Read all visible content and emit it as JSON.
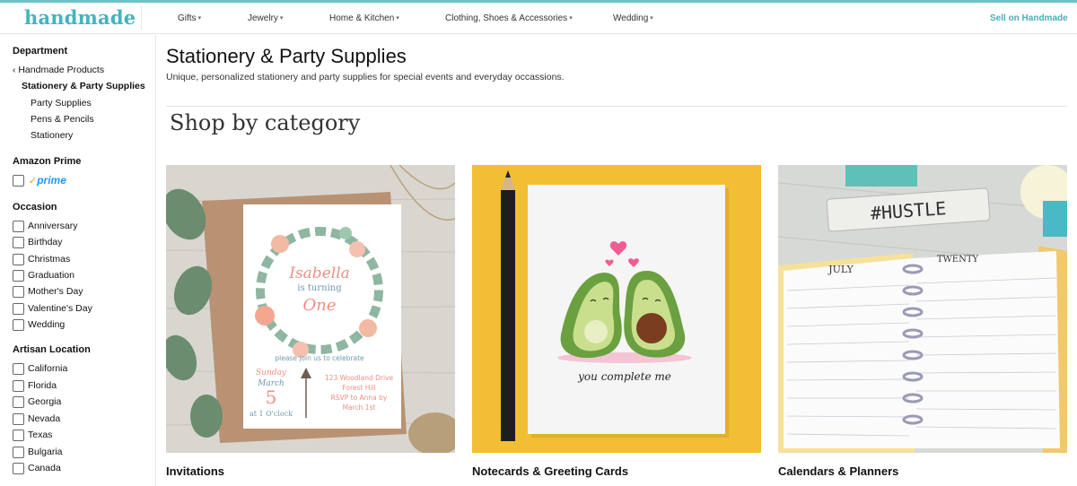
{
  "brand": {
    "logo_text": "handmade",
    "sell_label": "Sell on Handmade",
    "accent": "#42b5bf"
  },
  "nav": [
    {
      "label": "Gifts"
    },
    {
      "label": "Jewelry"
    },
    {
      "label": "Home & Kitchen"
    },
    {
      "label": "Clothing, Shoes & Accessories"
    },
    {
      "label": "Wedding"
    }
  ],
  "sidebar": {
    "department_heading": "Department",
    "back_link": "Handmade Products",
    "current": "Stationery & Party Supplies",
    "sub_links": [
      "Party Supplies",
      "Pens & Pencils",
      "Stationery"
    ],
    "prime_heading": "Amazon Prime",
    "prime_check": "✓",
    "prime_word": "prime",
    "occasion_heading": "Occasion",
    "occasions": [
      "Anniversary",
      "Birthday",
      "Christmas",
      "Graduation",
      "Mother's Day",
      "Valentine's Day",
      "Wedding"
    ],
    "location_heading": "Artisan Location",
    "locations": [
      "California",
      "Florida",
      "Georgia",
      "Nevada",
      "Texas",
      "Bulgaria",
      "Canada"
    ]
  },
  "main": {
    "title": "Stationery & Party Supplies",
    "subtitle": "Unique, personalized stationery and party supplies for special events and everyday occassions.",
    "shop_heading": "Shop by category",
    "categories": [
      {
        "label": "Invitations",
        "image": "invitation-card-image"
      },
      {
        "label": "Notecards & Greeting Cards",
        "image": "avocado-greeting-card-image"
      },
      {
        "label": "Calendars & Planners",
        "image": "planner-calendar-image"
      }
    ]
  },
  "card_art": {
    "invite_name": "Isabella",
    "invite_line2": "is turning",
    "invite_age": "One",
    "invite_celebrate": "please join us to celebrate",
    "invite_date1": "Sunday",
    "invite_date2": "March",
    "invite_date3": "5",
    "invite_date4": "at 1 O'clock",
    "invite_addr1": "123 Woodland Drive",
    "invite_addr2": "Forest Hill",
    "invite_addr3": "RSVP to Anna by",
    "invite_addr4": "March 1st",
    "avocado_caption": "you complete me",
    "hustle": "#HUSTLE",
    "planner_month": "JULY",
    "planner_year": "TWENTY"
  }
}
